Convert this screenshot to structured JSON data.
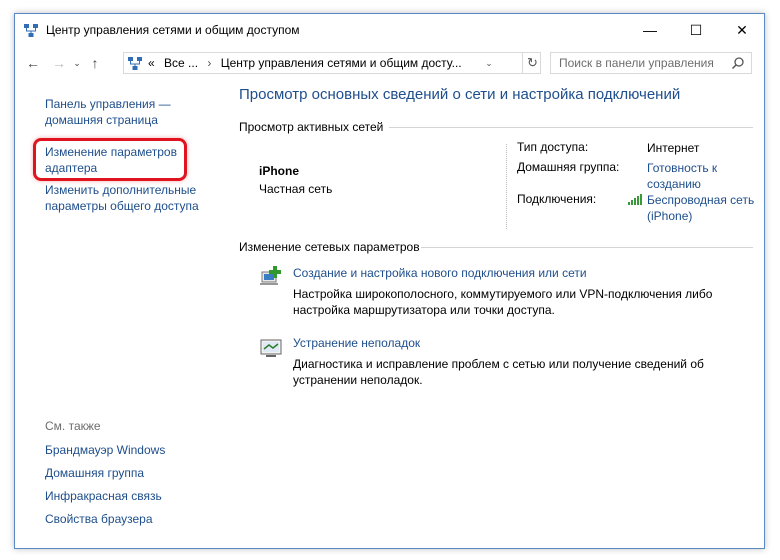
{
  "window": {
    "title": "Центр управления сетями и общим доступом",
    "controls": {
      "minimize": "—",
      "maximize": "☐",
      "close": "✕"
    }
  },
  "nav": {
    "back": "←",
    "forward": "→",
    "recent": "⌄",
    "up": "↑",
    "address": {
      "prefix": "«",
      "segment1": "Все ...",
      "separator": "›",
      "segment2": "Центр управления сетями и общим досту..."
    },
    "refresh": "↻",
    "search_placeholder": "Поиск в панели управления"
  },
  "sidebar": {
    "home": "Панель управления — домашняя страница",
    "adapter": "Изменение параметров адаптера",
    "sharing": "Изменить дополнительные параметры общего доступа",
    "see_also": "См. также",
    "links": [
      "Брандмауэр Windows",
      "Домашняя группа",
      "Инфракрасная связь",
      "Свойства браузера"
    ]
  },
  "main": {
    "heading": "Просмотр основных сведений о сети и настройка подключений",
    "active_section": "Просмотр активных сетей",
    "network": {
      "name": "iPhone",
      "type": "Частная сеть",
      "access_label": "Тип доступа:",
      "access_value": "Интернет",
      "homegroup_label": "Домашняя группа:",
      "homegroup_value": "Готовность к созданию",
      "connections_label": "Подключения:",
      "connections_value": "Беспроводная сеть (iPhone)"
    },
    "change_section": "Изменение сетевых параметров",
    "tasks": [
      {
        "title": "Создание и настройка нового подключения или сети",
        "desc": "Настройка широкополосного, коммутируемого или VPN-подключения либо настройка маршрутизатора или точки доступа."
      },
      {
        "title": "Устранение неполадок",
        "desc": "Диагностика и исправление проблем с сетью или получение сведений об устранении неполадок."
      }
    ]
  },
  "icons": {
    "app": "network-center-icon",
    "search": "search-icon",
    "wifi": "wifi-signal-icon",
    "new_connection": "new-connection-icon",
    "troubleshoot": "troubleshoot-icon"
  },
  "colors": {
    "link": "#1e4e8c",
    "highlight": "#e0141e",
    "window_border": "#5a8ac6"
  }
}
